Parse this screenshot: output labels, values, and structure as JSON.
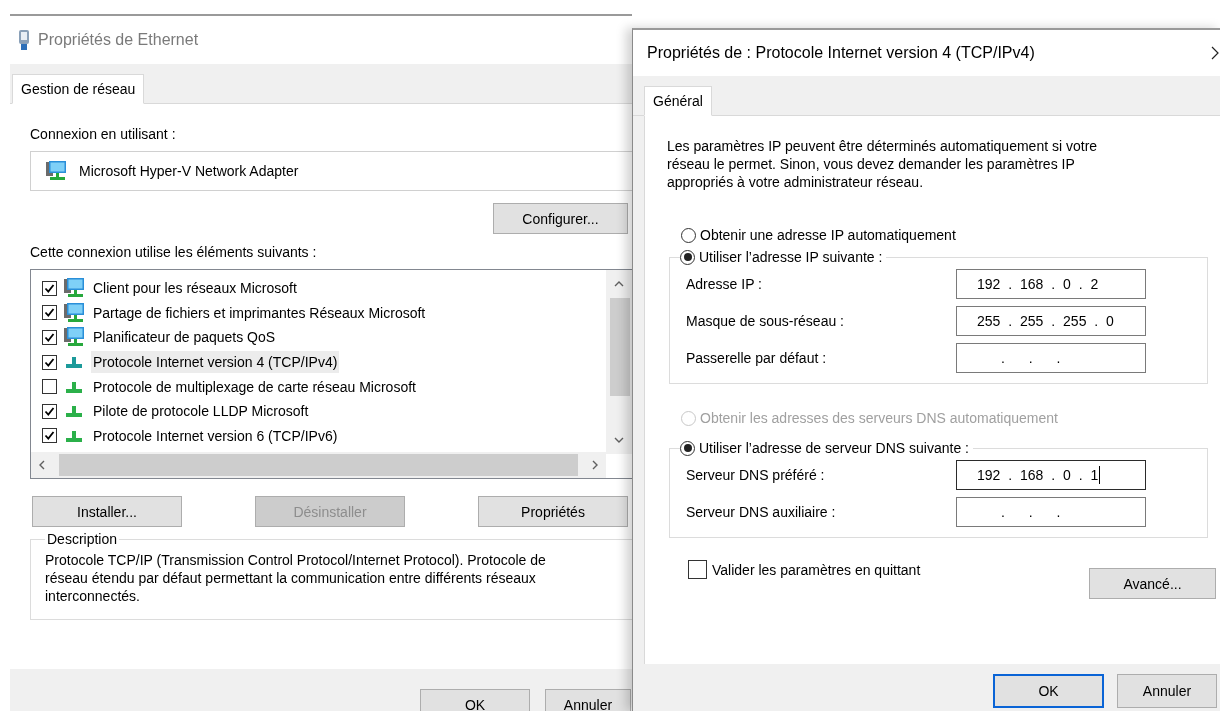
{
  "ethernet_window": {
    "title": "Propriétés de Ethernet",
    "tabs": [
      {
        "label": "Gestion de réseau",
        "selected": true
      }
    ],
    "connect_using_label": "Connexion en utilisant :",
    "adapter": "Microsoft Hyper-V Network Adapter",
    "configure_button": "Configurer...",
    "items_label": "Cette connexion utilise les éléments suivants :",
    "items": [
      {
        "label": "Client pour les réseaux Microsoft",
        "kind": "client",
        "checked": true,
        "selected": false
      },
      {
        "label": "Partage de fichiers et imprimantes Réseaux Microsoft",
        "kind": "service",
        "checked": true,
        "selected": false
      },
      {
        "label": "Planificateur de paquets QoS",
        "kind": "service",
        "checked": true,
        "selected": false
      },
      {
        "label": "Protocole Internet version 4 (TCP/IPv4)",
        "kind": "protocol",
        "checked": true,
        "selected": true
      },
      {
        "label": "Protocole de multiplexage de carte réseau Microsoft",
        "kind": "protocol",
        "checked": false,
        "selected": false
      },
      {
        "label": "Pilote de protocole LLDP Microsoft",
        "kind": "protocol",
        "checked": true,
        "selected": false
      },
      {
        "label": "Protocole Internet version 6 (TCP/IPv6)",
        "kind": "protocol",
        "checked": true,
        "selected": false
      }
    ],
    "buttons": [
      {
        "label": "Installer...",
        "disabled": false
      },
      {
        "label": "Désinstaller",
        "disabled": true
      },
      {
        "label": "Propriétés",
        "disabled": false
      }
    ],
    "description": {
      "legend": "Description",
      "text": "Protocole TCP/IP (Transmission Control Protocol/Internet Protocol). Protocole de réseau étendu par défaut permettant la communication entre différents réseaux interconnectés."
    },
    "footer_buttons": [
      {
        "label": "OK",
        "default": false
      },
      {
        "label": "Annuler",
        "default": false
      }
    ]
  },
  "ipv4_dialog": {
    "title": "Propriétés de : Protocole Internet version 4 (TCP/IPv4)",
    "tabs": [
      {
        "label": "Général",
        "selected": true
      }
    ],
    "intro": "Les paramètres IP peuvent être déterminés automatiquement si votre réseau le permet. Sinon, vous devez demander les paramètres IP appropriés à votre administrateur réseau.",
    "ip_options": [
      {
        "label": "Obtenir une adresse IP automatiquement",
        "selected": false,
        "disabled": false
      },
      {
        "label": "Utiliser l’adresse IP suivante :",
        "selected": true,
        "disabled": false
      }
    ],
    "ip_fields": [
      {
        "label": "Adresse IP :",
        "value": "192 . 168 . 0 . 2",
        "focused": false
      },
      {
        "label": "Masque de sous-réseau :",
        "value": "255 . 255 . 255 . 0",
        "focused": false
      },
      {
        "label": "Passerelle par défaut :",
        "value": ". . .",
        "focused": false
      }
    ],
    "dns_options": [
      {
        "label": "Obtenir les adresses des serveurs DNS automatiquement",
        "selected": false,
        "disabled": true
      },
      {
        "label": "Utiliser l’adresse de serveur DNS suivante :",
        "selected": true,
        "disabled": false
      }
    ],
    "dns_fields": [
      {
        "label": "Serveur DNS préféré :",
        "value": "192 . 168 . 0 . 1",
        "focused": true
      },
      {
        "label": "Serveur DNS auxiliaire :",
        "value": ". . .",
        "focused": false
      }
    ],
    "validate": {
      "label": "Valider les paramètres en quittant",
      "checked": false
    },
    "advanced_button": "Avancé...",
    "footer_buttons": [
      {
        "label": "OK",
        "default": true
      },
      {
        "label": "Annuler",
        "default": false
      }
    ]
  }
}
